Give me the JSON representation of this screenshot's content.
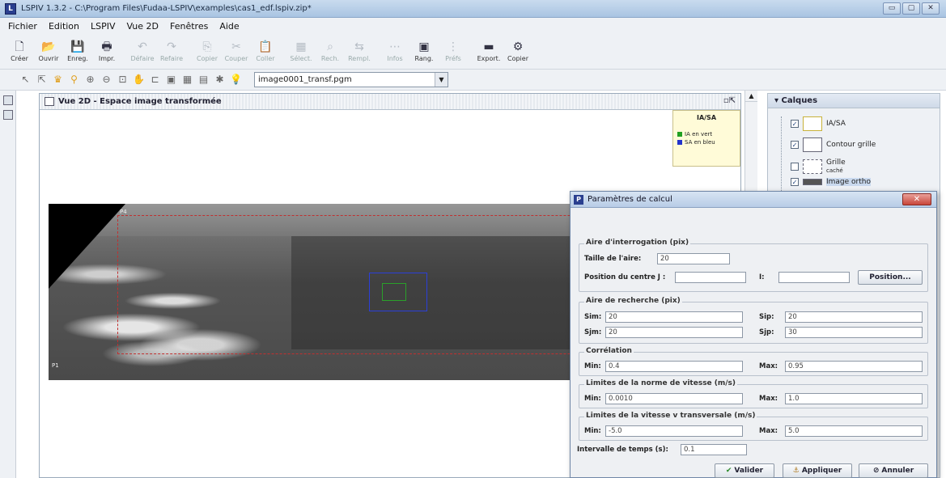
{
  "window": {
    "title": "LSPIV 1.3.2 - C:\\Program Files\\Fudaa-LSPIV\\examples\\cas1_edf.lspiv.zip*",
    "controls": [
      "▭",
      "▢",
      "✕"
    ]
  },
  "menu": [
    "Fichier",
    "Edition",
    "LSPIV",
    "Vue 2D",
    "Fenêtres",
    "Aide"
  ],
  "toolbar": [
    {
      "icon": "🗋",
      "label": "Créer",
      "enabled": true
    },
    {
      "icon": "📂",
      "label": "Ouvrir",
      "enabled": true
    },
    {
      "icon": "💾",
      "label": "Enreg.",
      "enabled": true
    },
    {
      "icon": "🖶",
      "label": "Impr.",
      "enabled": true
    },
    {
      "icon": "↶",
      "label": "Défaire",
      "enabled": false
    },
    {
      "icon": "↷",
      "label": "Refaire",
      "enabled": false
    },
    {
      "icon": "⎘",
      "label": "Copier",
      "enabled": false
    },
    {
      "icon": "✂",
      "label": "Couper",
      "enabled": false
    },
    {
      "icon": "📋",
      "label": "Coller",
      "enabled": false
    },
    {
      "icon": "▦",
      "label": "Sélect.",
      "enabled": false
    },
    {
      "icon": "⌕",
      "label": "Rech.",
      "enabled": false
    },
    {
      "icon": "⇆",
      "label": "Rempl.",
      "enabled": false
    },
    {
      "icon": "⋯",
      "label": "Infos",
      "enabled": false
    },
    {
      "icon": "▣",
      "label": "Rang.",
      "enabled": true
    },
    {
      "icon": "⋮",
      "label": "Préfs",
      "enabled": false
    },
    {
      "icon": "▬",
      "label": "Export.",
      "enabled": true
    },
    {
      "icon": "⚙",
      "label": "Copier",
      "enabled": true
    }
  ],
  "image_selector": {
    "value": "image0001_transf.pgm"
  },
  "vue2d": {
    "title": "Vue 2D - Espace image transformée",
    "legend": {
      "title": "IA/SA",
      "items": [
        {
          "label": "IA en vert",
          "color": "#21a021"
        },
        {
          "label": "SA en bleu",
          "color": "#2233cc"
        }
      ]
    },
    "corner_labels": [
      "P4",
      "P1"
    ]
  },
  "calques": {
    "title": "Calques",
    "items": [
      {
        "label": "IA/SA",
        "checked": true,
        "selected": false
      },
      {
        "label": "Contour grille",
        "checked": true,
        "selected": false
      },
      {
        "label": "Grille",
        "sublabel": "caché",
        "checked": false,
        "selected": false
      },
      {
        "label": "Image ortho",
        "checked": true,
        "selected": true
      }
    ]
  },
  "dialog": {
    "title": "Paramètres de calcul",
    "aire_interrogation": {
      "legend": "Aire d'interrogation (pix)",
      "taille_label": "Taille de l'aire:",
      "taille_value": "20",
      "position_label": "Position du centre  J :",
      "position_j": "",
      "i_label": "I:",
      "position_i": "",
      "position_button": "Position..."
    },
    "aire_recherche": {
      "legend": "Aire de recherche (pix)",
      "sim_label": "Sim:",
      "sim_value": "20",
      "sip_label": "Sip:",
      "sip_value": "20",
      "sjm_label": "Sjm:",
      "sjm_value": "20",
      "sjp_label": "Sjp:",
      "sjp_value": "30"
    },
    "correlation": {
      "legend": "Corrélation",
      "min_label": "Min:",
      "min_value": "0.4",
      "max_label": "Max:",
      "max_value": "0.95"
    },
    "norme_vitesse": {
      "legend": "Limites de la norme de vitesse (m/s)",
      "min_label": "Min:",
      "min_value": "0.0010",
      "max_label": "Max:",
      "max_value": "1.0"
    },
    "vitesse_transversale": {
      "legend": "Limites de la vitesse v transversale (m/s)",
      "min_label": "Min:",
      "min_value": "-5.0",
      "max_label": "Max:",
      "max_value": "5.0"
    },
    "intervalle_label": "Intervalle de temps (s):",
    "intervalle_value": "0.1",
    "buttons": {
      "valider": "Valider",
      "appliquer": "Appliquer",
      "annuler": "Annuler"
    }
  }
}
